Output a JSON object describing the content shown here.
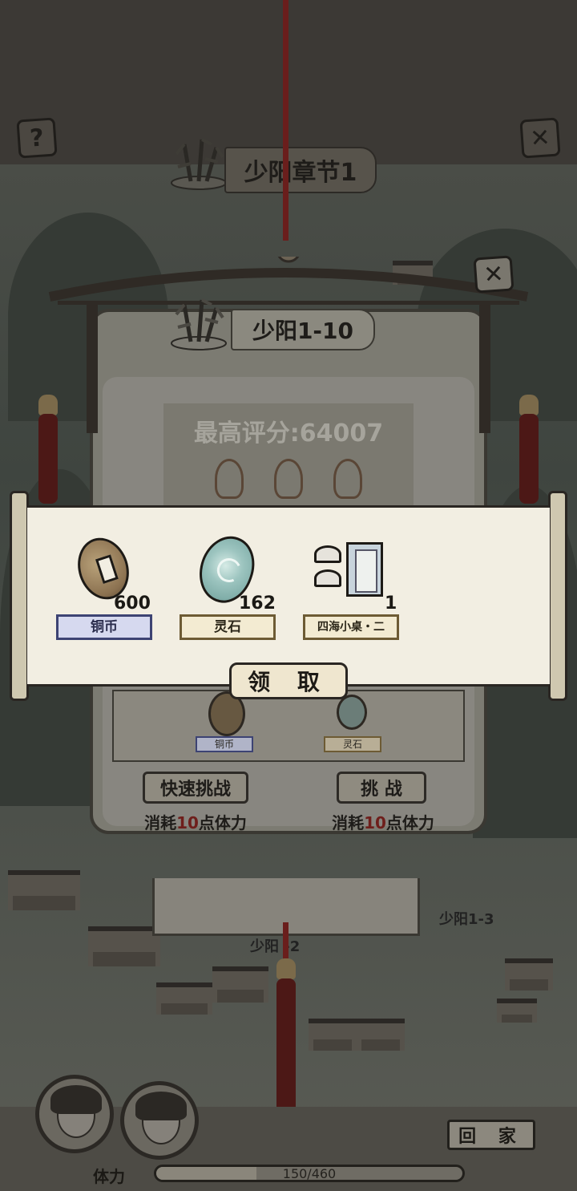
{
  "header": {
    "help_icon": "question-icon",
    "close_icon": "close-icon",
    "chapter_title": "少阳章节1"
  },
  "level_card": {
    "title": "少阳1-10",
    "close_icon": "close-icon",
    "best_score": "最高评分:64007",
    "stars_earned": 0,
    "stars_total": 3,
    "preview_rewards": [
      {
        "label": "铜币"
      },
      {
        "label": "灵石"
      }
    ],
    "quick_challenge_label": "快速挑战",
    "challenge_label": "挑 战",
    "cost_prefix": "消耗",
    "cost_value": "10",
    "cost_suffix": "点体力"
  },
  "reward_popup": {
    "items": [
      {
        "name": "铜币",
        "count": "600",
        "icon": "copper-coin-icon"
      },
      {
        "name": "灵石",
        "count": "162",
        "icon": "spirit-stone-icon"
      },
      {
        "name": "四海小桌・二",
        "count": "1",
        "icon": "table-furniture-icon"
      }
    ],
    "claim_label": "领 取"
  },
  "map": {
    "labels": [
      "少阳1-3",
      "少阳 -2"
    ]
  },
  "hud": {
    "home_label": "回 家",
    "stamina_label": "体力",
    "stamina_text": "150/460",
    "stamina_current": 150,
    "stamina_max": 460
  },
  "colors": {
    "accent_red": "#6e1e1b",
    "scroll_paper": "#f2eee2",
    "label_blue": "#3d4373",
    "label_gold": "#6d5b34"
  }
}
